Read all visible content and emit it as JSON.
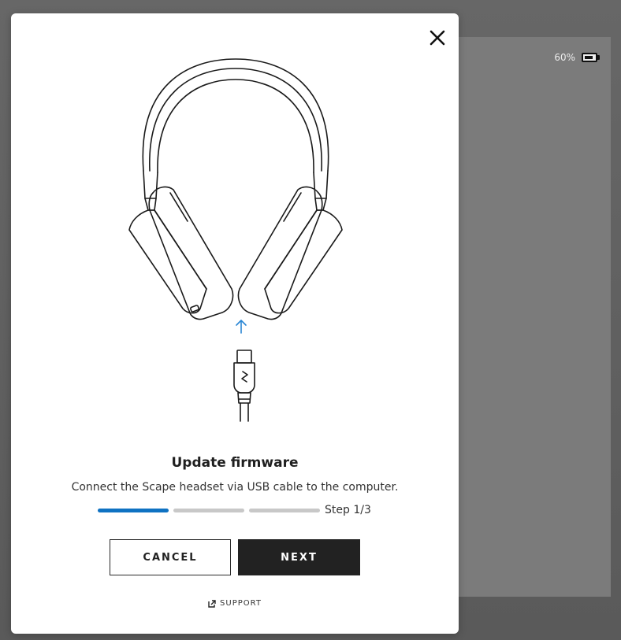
{
  "background": {
    "battery": {
      "percent_label": "60%",
      "level": 0.6
    }
  },
  "modal": {
    "title": "Update firmware",
    "description": "Connect the Scape headset via USB cable to the computer.",
    "progress": {
      "total_steps": 3,
      "current_step": 1,
      "step_label": "Step 1/3",
      "active_color": "#0f72c2",
      "inactive_color": "#c8c8c8"
    },
    "cancel_label": "CANCEL",
    "next_label": "NEXT",
    "support_label": "SUPPORT",
    "arrow_color": "#2a86d4"
  }
}
